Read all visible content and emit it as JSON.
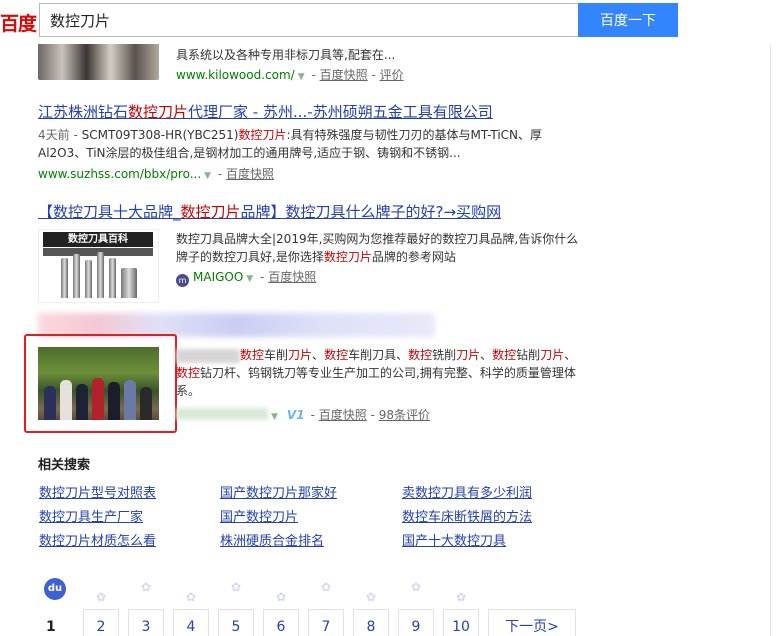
{
  "header": {
    "logo_text": "百度",
    "query": "数控刀片",
    "search_button": "百度一下"
  },
  "results": [
    {
      "abstract": "具系统以及各种专用非标刀具等,配套在...",
      "url": "www.kilowood.com/",
      "snapshot": "百度快照",
      "review": "评价"
    },
    {
      "title_a": "江苏株洲钻石",
      "title_hl": "数控刀片",
      "title_b": "代理厂家 - 苏州...-苏州硕朔五金工具有限公司",
      "abs_date": "4天前 - ",
      "abs_a": "SCMT09T308-HR(YBC251)",
      "abs_hl": "数控刀片",
      "abs_b": ":具有特殊强度与韧性刀刃的基体与MT-TiCN、厚Al2O3、TiN涂层的极佳组合,是钢材加工的通用牌号,适应于钢、铸钢和不锈钢...",
      "url": "www.suzhss.com/bbx/pro...",
      "snapshot": "百度快照"
    },
    {
      "title_a": "【数控刀具十大品牌_",
      "title_hl": "数控刀片",
      "title_b": "品牌】数控刀具什么牌子的好?→买购网",
      "image_caption": "数控刀具百科",
      "abs_a": "数控刀具品牌大全|2019年,买购网为您推荐最好的数控刀具品牌,告诉你什么牌子的数控刀具好,是你选择",
      "abs_hl": "数控刀片",
      "abs_b": "品牌的参考网站",
      "source": "MAIGOO",
      "snapshot": "百度快照"
    },
    {
      "abs_parts": [
        {
          "t": "数控",
          "hl": true
        },
        {
          "t": "车削",
          "hl": false
        },
        {
          "t": "刀片",
          "hl": true
        },
        {
          "t": "、",
          "hl": false
        },
        {
          "t": "数控",
          "hl": true
        },
        {
          "t": "车削刀具、",
          "hl": false
        },
        {
          "t": "数控",
          "hl": true
        },
        {
          "t": "铣削",
          "hl": false
        },
        {
          "t": "刀片",
          "hl": true
        },
        {
          "t": "、",
          "hl": false
        },
        {
          "t": "数控",
          "hl": true
        },
        {
          "t": "钻削",
          "hl": false
        },
        {
          "t": "刀片",
          "hl": true
        },
        {
          "t": "、",
          "hl": false
        },
        {
          "t": "数控",
          "hl": true
        },
        {
          "t": "钻刀杆、钨钢铣刀等专业生产加工的公司,拥有完整、科学的质量管理体系。",
          "hl": false
        }
      ],
      "v_badge": "V1",
      "snapshot": "百度快照",
      "review": "98条评价"
    }
  ],
  "related": {
    "title": "相关搜索",
    "items": [
      "数控刀片型号对照表",
      "国产数控刀片那家好",
      "卖数控刀具有多少利润",
      "数控刀具生产厂家",
      "国产数控刀片",
      "数控车床断铁屑的方法",
      "数控刀片材质怎么看",
      "株洲硬质合金排名",
      "国产十大数控刀具"
    ]
  },
  "pagination": {
    "current": "1",
    "pages": [
      "2",
      "3",
      "4",
      "5",
      "6",
      "7",
      "8",
      "9",
      "10"
    ],
    "next": "下一页>",
    "paw_logo": "du"
  },
  "colors": {
    "link": "#2440b3",
    "highlight": "#cc0000",
    "url": "#008000",
    "brand_red": "#e10602",
    "search_button": "#3385ff",
    "annotation_box": "#e31e1e"
  }
}
